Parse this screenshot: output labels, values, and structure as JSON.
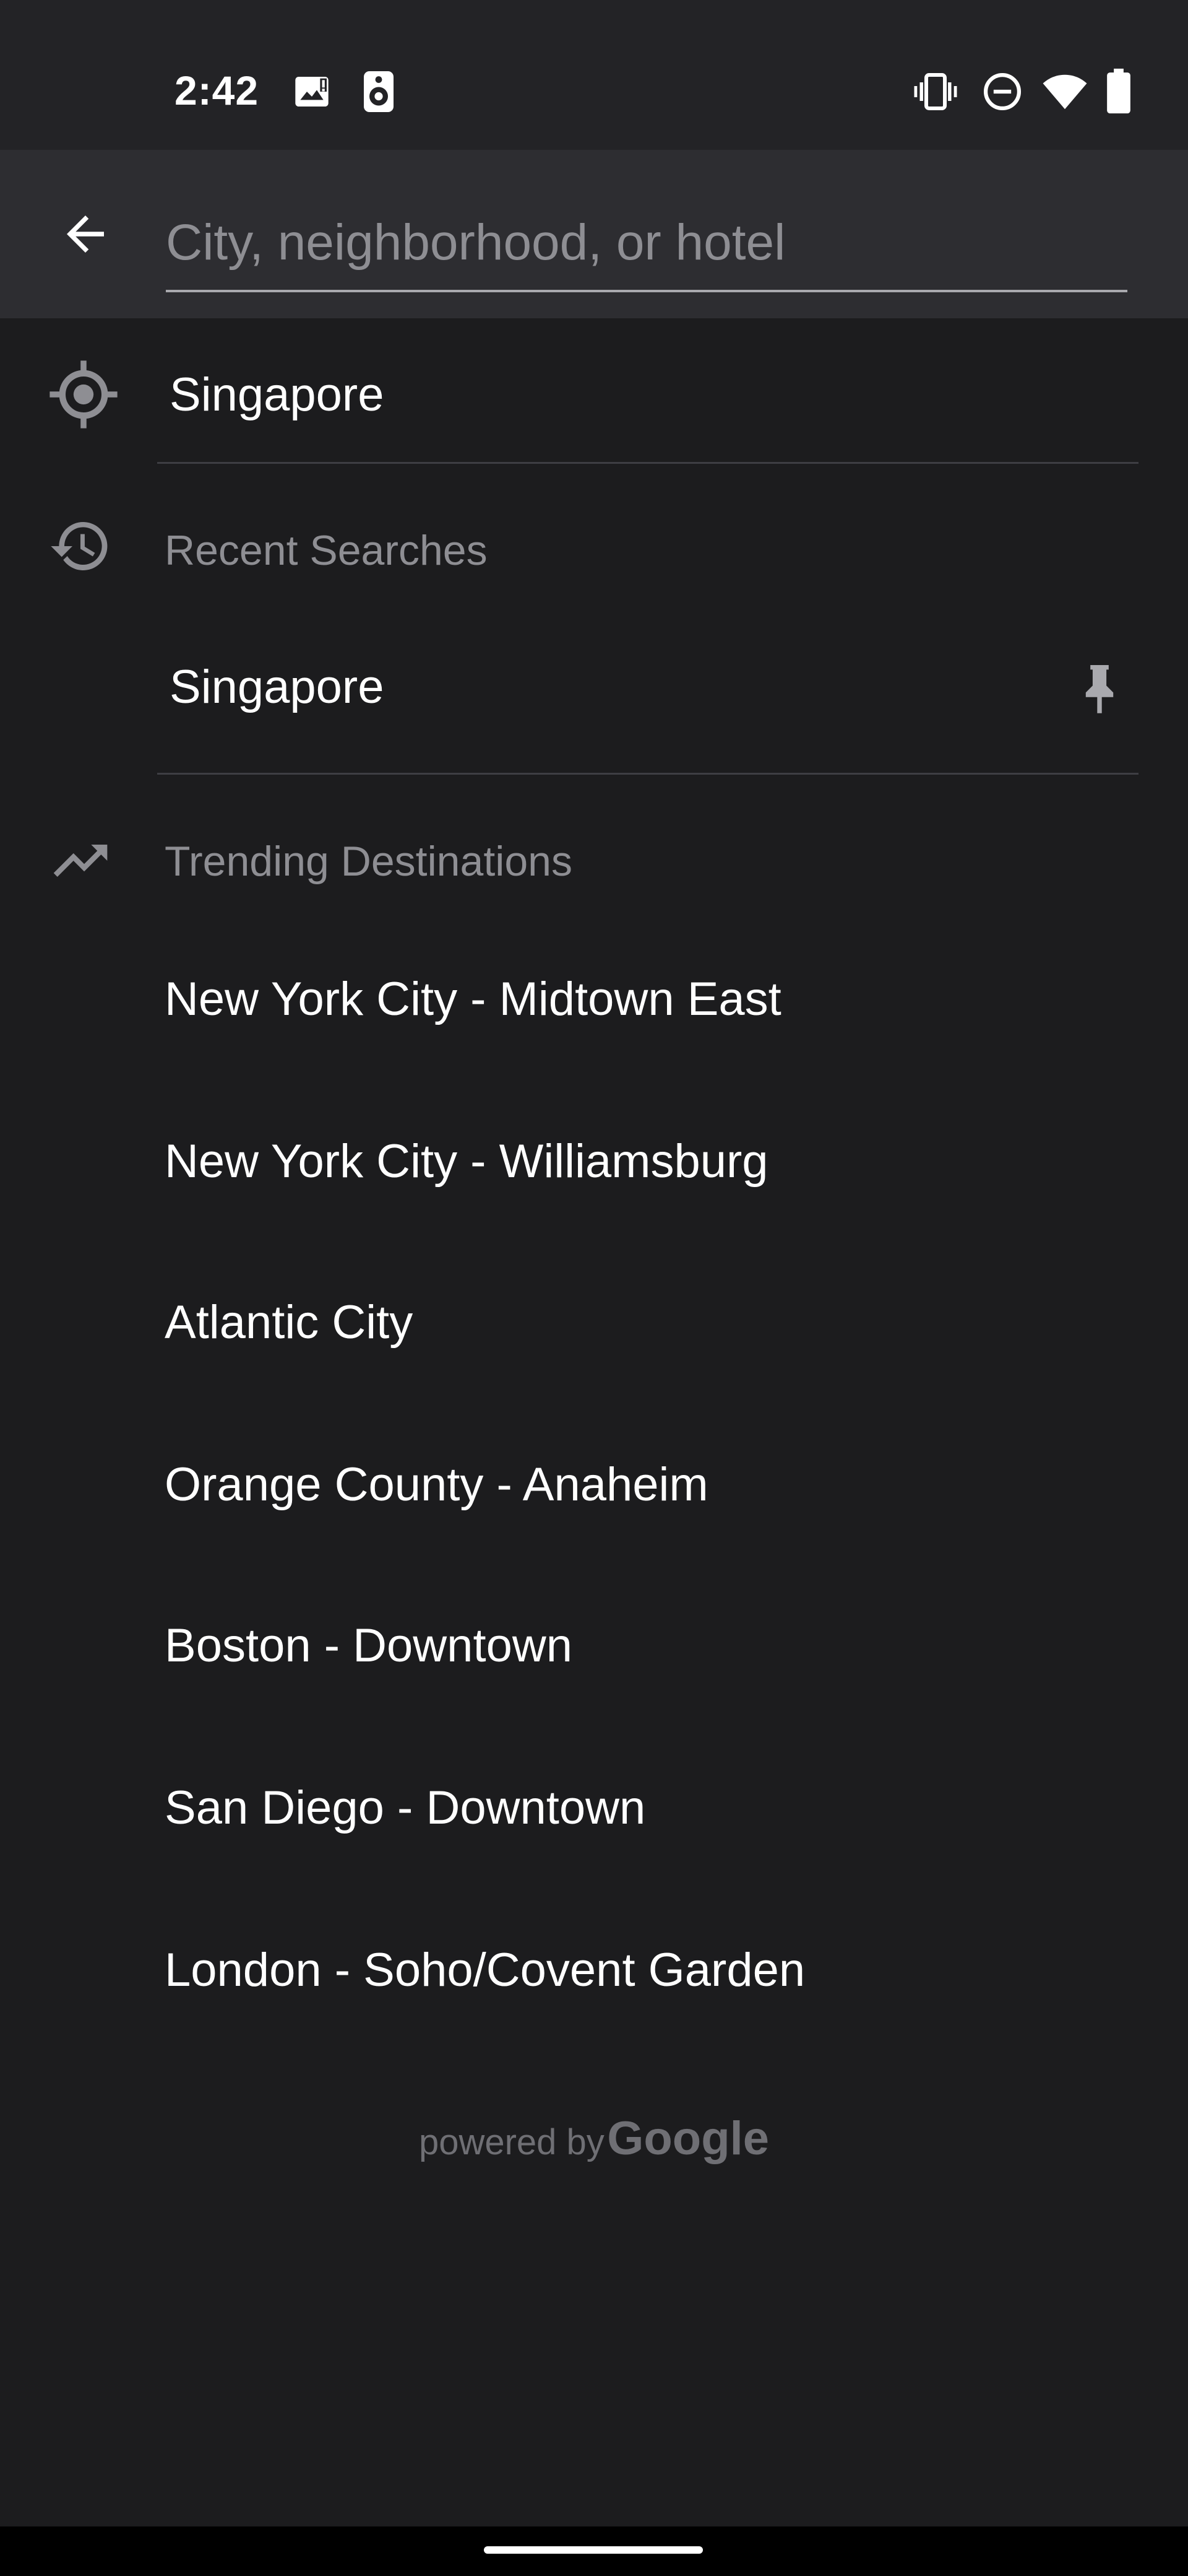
{
  "status_bar": {
    "time": "2:42",
    "left_icons": [
      "image-notification-icon",
      "speaker-notification-icon"
    ],
    "right_icons": [
      "vibrate-icon",
      "do-not-disturb-icon",
      "wifi-icon",
      "battery-icon"
    ]
  },
  "search": {
    "back_icon": "back-arrow-icon",
    "value": "",
    "placeholder": "City, neighborhood, or hotel"
  },
  "current_location": {
    "icon": "my-location-icon",
    "label": "Singapore"
  },
  "recent_searches": {
    "icon": "history-icon",
    "title": "Recent Searches",
    "items": [
      {
        "label": "Singapore",
        "icon": "pin-icon"
      }
    ]
  },
  "trending": {
    "icon": "trending-up-icon",
    "title": "Trending Destinations",
    "items": [
      "New York City - Midtown East",
      "New York City - Williamsburg",
      "Atlantic City",
      "Orange County - Anaheim",
      "Boston - Downtown",
      "San Diego - Downtown",
      "London - Soho/Covent Garden"
    ]
  },
  "attribution": {
    "prefix": "powered by",
    "brand": "Google"
  },
  "colors": {
    "background": "#1c1c1e",
    "header": "#2d2d31",
    "primary_text": "#ffffff",
    "secondary_text": "#8e8e93"
  }
}
